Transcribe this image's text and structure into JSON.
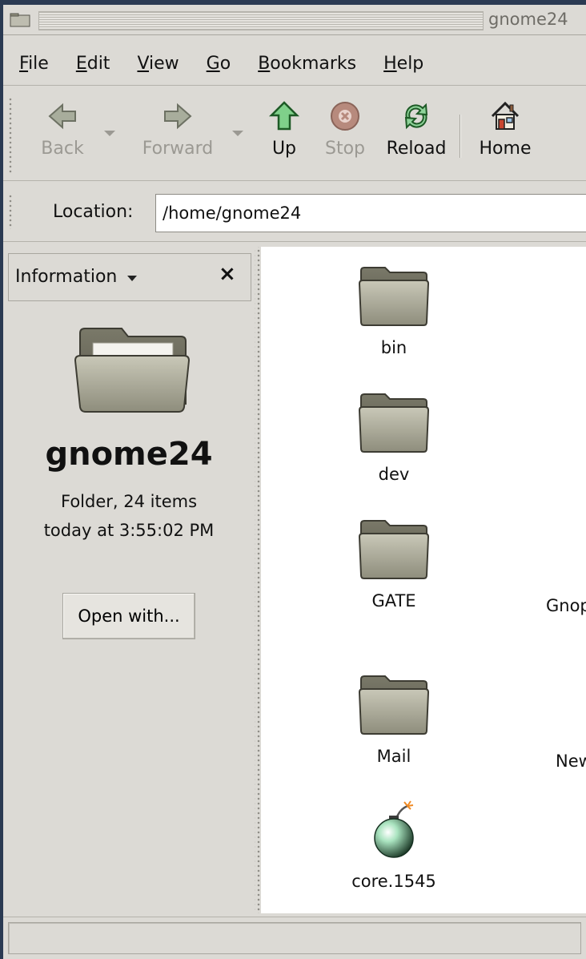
{
  "window": {
    "title": "gnome24",
    "icon": "folder-window-icon"
  },
  "menubar": {
    "items": [
      {
        "mnemonic": "F",
        "rest": "ile"
      },
      {
        "mnemonic": "E",
        "rest": "dit"
      },
      {
        "mnemonic": "V",
        "rest": "iew"
      },
      {
        "mnemonic": "G",
        "rest": "o"
      },
      {
        "mnemonic": "B",
        "rest": "ookmarks"
      },
      {
        "mnemonic": "H",
        "rest": "elp"
      }
    ]
  },
  "toolbar": {
    "back": {
      "label": "Back",
      "icon": "back-arrow-icon",
      "enabled": false
    },
    "forward": {
      "label": "Forward",
      "icon": "forward-arrow-icon",
      "enabled": false
    },
    "up": {
      "label": "Up",
      "icon": "up-arrow-icon",
      "enabled": true
    },
    "stop": {
      "label": "Stop",
      "icon": "stop-icon",
      "enabled": false
    },
    "reload": {
      "label": "Reload",
      "icon": "reload-icon",
      "enabled": true
    },
    "home": {
      "label": "Home",
      "icon": "home-icon",
      "enabled": true
    }
  },
  "location": {
    "label": "Location:",
    "value": "/home/gnome24"
  },
  "sidebar": {
    "header": "Information",
    "close_glyph": "×",
    "folder_name": "gnome24",
    "details": "Folder, 24 items",
    "modified": "today at 3:55:02 PM",
    "open_with_label": "Open with..."
  },
  "files": [
    {
      "name": "bin",
      "icon": "folder-icon"
    },
    {
      "name": "dev",
      "icon": "folder-icon"
    },
    {
      "name": "GATE",
      "icon": "folder-icon"
    },
    {
      "name": "Mail",
      "icon": "folder-icon"
    },
    {
      "name": "core.1545",
      "icon": "bomb-core-icon"
    }
  ],
  "partial_labels": [
    "Gnop",
    "New"
  ],
  "status": {
    "text": ""
  },
  "colors": {
    "window_bg": "#dcdad5",
    "desktop": "#2a3a52",
    "folder": "#a9a897"
  }
}
